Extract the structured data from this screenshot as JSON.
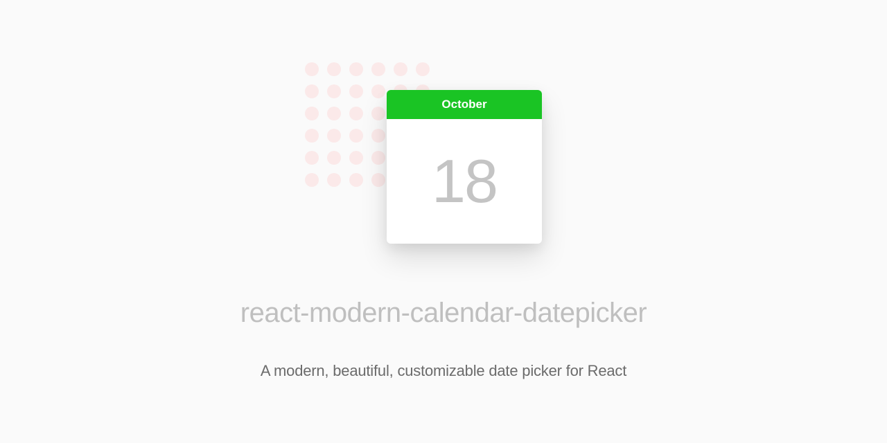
{
  "colors": {
    "background": "#fafafa",
    "headerGreen": "#1ac424",
    "dotPink": "#fbe9e9",
    "titleGray": "#bfbfbf",
    "subtitleGray": "#6b6b6b",
    "dayGray": "#c4c4c4"
  },
  "hero": {
    "month": "October",
    "day": "18"
  },
  "title": "react-modern-calendar-datepicker",
  "subtitle": "A modern, beautiful, customizable date picker for React"
}
